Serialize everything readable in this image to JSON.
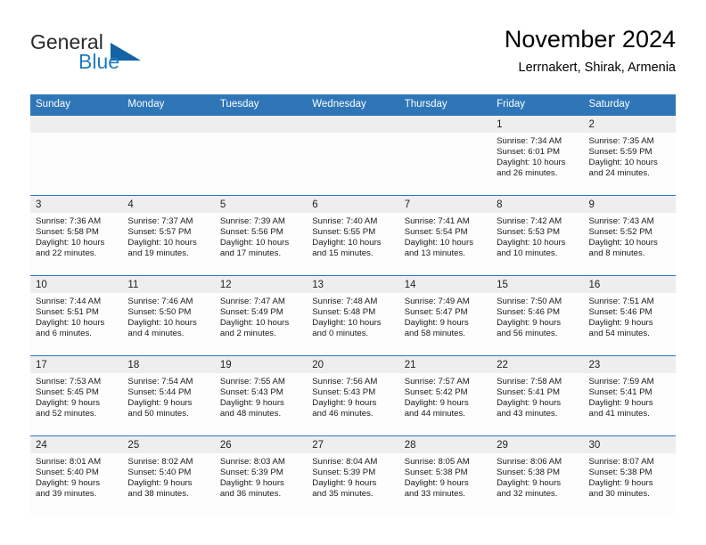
{
  "brand": {
    "name_part1": "General",
    "name_part2": "Blue",
    "accent_color": "#1464a5",
    "blue_text_color": "#1f7bc1"
  },
  "header": {
    "month_title": "November 2024",
    "location": "Lerrnakert, Shirak, Armenia"
  },
  "calendar": {
    "header_color": "#2e76b8",
    "weekdays": [
      "Sunday",
      "Monday",
      "Tuesday",
      "Wednesday",
      "Thursday",
      "Friday",
      "Saturday"
    ],
    "labels": {
      "sunrise": "Sunrise:",
      "sunset": "Sunset:",
      "daylight": "Daylight:"
    },
    "weeks": [
      [
        {
          "empty": true
        },
        {
          "empty": true
        },
        {
          "empty": true
        },
        {
          "empty": true
        },
        {
          "empty": true
        },
        {
          "day": "1",
          "sunrise": "Sunrise: 7:34 AM",
          "sunset": "Sunset: 6:01 PM",
          "daylight_line1": "Daylight: 10 hours",
          "daylight_line2": "and 26 minutes."
        },
        {
          "day": "2",
          "sunrise": "Sunrise: 7:35 AM",
          "sunset": "Sunset: 5:59 PM",
          "daylight_line1": "Daylight: 10 hours",
          "daylight_line2": "and 24 minutes."
        }
      ],
      [
        {
          "day": "3",
          "sunrise": "Sunrise: 7:36 AM",
          "sunset": "Sunset: 5:58 PM",
          "daylight_line1": "Daylight: 10 hours",
          "daylight_line2": "and 22 minutes."
        },
        {
          "day": "4",
          "sunrise": "Sunrise: 7:37 AM",
          "sunset": "Sunset: 5:57 PM",
          "daylight_line1": "Daylight: 10 hours",
          "daylight_line2": "and 19 minutes."
        },
        {
          "day": "5",
          "sunrise": "Sunrise: 7:39 AM",
          "sunset": "Sunset: 5:56 PM",
          "daylight_line1": "Daylight: 10 hours",
          "daylight_line2": "and 17 minutes."
        },
        {
          "day": "6",
          "sunrise": "Sunrise: 7:40 AM",
          "sunset": "Sunset: 5:55 PM",
          "daylight_line1": "Daylight: 10 hours",
          "daylight_line2": "and 15 minutes."
        },
        {
          "day": "7",
          "sunrise": "Sunrise: 7:41 AM",
          "sunset": "Sunset: 5:54 PM",
          "daylight_line1": "Daylight: 10 hours",
          "daylight_line2": "and 13 minutes."
        },
        {
          "day": "8",
          "sunrise": "Sunrise: 7:42 AM",
          "sunset": "Sunset: 5:53 PM",
          "daylight_line1": "Daylight: 10 hours",
          "daylight_line2": "and 10 minutes."
        },
        {
          "day": "9",
          "sunrise": "Sunrise: 7:43 AM",
          "sunset": "Sunset: 5:52 PM",
          "daylight_line1": "Daylight: 10 hours",
          "daylight_line2": "and 8 minutes."
        }
      ],
      [
        {
          "day": "10",
          "sunrise": "Sunrise: 7:44 AM",
          "sunset": "Sunset: 5:51 PM",
          "daylight_line1": "Daylight: 10 hours",
          "daylight_line2": "and 6 minutes."
        },
        {
          "day": "11",
          "sunrise": "Sunrise: 7:46 AM",
          "sunset": "Sunset: 5:50 PM",
          "daylight_line1": "Daylight: 10 hours",
          "daylight_line2": "and 4 minutes."
        },
        {
          "day": "12",
          "sunrise": "Sunrise: 7:47 AM",
          "sunset": "Sunset: 5:49 PM",
          "daylight_line1": "Daylight: 10 hours",
          "daylight_line2": "and 2 minutes."
        },
        {
          "day": "13",
          "sunrise": "Sunrise: 7:48 AM",
          "sunset": "Sunset: 5:48 PM",
          "daylight_line1": "Daylight: 10 hours",
          "daylight_line2": "and 0 minutes."
        },
        {
          "day": "14",
          "sunrise": "Sunrise: 7:49 AM",
          "sunset": "Sunset: 5:47 PM",
          "daylight_line1": "Daylight: 9 hours",
          "daylight_line2": "and 58 minutes."
        },
        {
          "day": "15",
          "sunrise": "Sunrise: 7:50 AM",
          "sunset": "Sunset: 5:46 PM",
          "daylight_line1": "Daylight: 9 hours",
          "daylight_line2": "and 56 minutes."
        },
        {
          "day": "16",
          "sunrise": "Sunrise: 7:51 AM",
          "sunset": "Sunset: 5:46 PM",
          "daylight_line1": "Daylight: 9 hours",
          "daylight_line2": "and 54 minutes."
        }
      ],
      [
        {
          "day": "17",
          "sunrise": "Sunrise: 7:53 AM",
          "sunset": "Sunset: 5:45 PM",
          "daylight_line1": "Daylight: 9 hours",
          "daylight_line2": "and 52 minutes."
        },
        {
          "day": "18",
          "sunrise": "Sunrise: 7:54 AM",
          "sunset": "Sunset: 5:44 PM",
          "daylight_line1": "Daylight: 9 hours",
          "daylight_line2": "and 50 minutes."
        },
        {
          "day": "19",
          "sunrise": "Sunrise: 7:55 AM",
          "sunset": "Sunset: 5:43 PM",
          "daylight_line1": "Daylight: 9 hours",
          "daylight_line2": "and 48 minutes."
        },
        {
          "day": "20",
          "sunrise": "Sunrise: 7:56 AM",
          "sunset": "Sunset: 5:43 PM",
          "daylight_line1": "Daylight: 9 hours",
          "daylight_line2": "and 46 minutes."
        },
        {
          "day": "21",
          "sunrise": "Sunrise: 7:57 AM",
          "sunset": "Sunset: 5:42 PM",
          "daylight_line1": "Daylight: 9 hours",
          "daylight_line2": "and 44 minutes."
        },
        {
          "day": "22",
          "sunrise": "Sunrise: 7:58 AM",
          "sunset": "Sunset: 5:41 PM",
          "daylight_line1": "Daylight: 9 hours",
          "daylight_line2": "and 43 minutes."
        },
        {
          "day": "23",
          "sunrise": "Sunrise: 7:59 AM",
          "sunset": "Sunset: 5:41 PM",
          "daylight_line1": "Daylight: 9 hours",
          "daylight_line2": "and 41 minutes."
        }
      ],
      [
        {
          "day": "24",
          "sunrise": "Sunrise: 8:01 AM",
          "sunset": "Sunset: 5:40 PM",
          "daylight_line1": "Daylight: 9 hours",
          "daylight_line2": "and 39 minutes."
        },
        {
          "day": "25",
          "sunrise": "Sunrise: 8:02 AM",
          "sunset": "Sunset: 5:40 PM",
          "daylight_line1": "Daylight: 9 hours",
          "daylight_line2": "and 38 minutes."
        },
        {
          "day": "26",
          "sunrise": "Sunrise: 8:03 AM",
          "sunset": "Sunset: 5:39 PM",
          "daylight_line1": "Daylight: 9 hours",
          "daylight_line2": "and 36 minutes."
        },
        {
          "day": "27",
          "sunrise": "Sunrise: 8:04 AM",
          "sunset": "Sunset: 5:39 PM",
          "daylight_line1": "Daylight: 9 hours",
          "daylight_line2": "and 35 minutes."
        },
        {
          "day": "28",
          "sunrise": "Sunrise: 8:05 AM",
          "sunset": "Sunset: 5:38 PM",
          "daylight_line1": "Daylight: 9 hours",
          "daylight_line2": "and 33 minutes."
        },
        {
          "day": "29",
          "sunrise": "Sunrise: 8:06 AM",
          "sunset": "Sunset: 5:38 PM",
          "daylight_line1": "Daylight: 9 hours",
          "daylight_line2": "and 32 minutes."
        },
        {
          "day": "30",
          "sunrise": "Sunrise: 8:07 AM",
          "sunset": "Sunset: 5:38 PM",
          "daylight_line1": "Daylight: 9 hours",
          "daylight_line2": "and 30 minutes."
        }
      ]
    ]
  }
}
